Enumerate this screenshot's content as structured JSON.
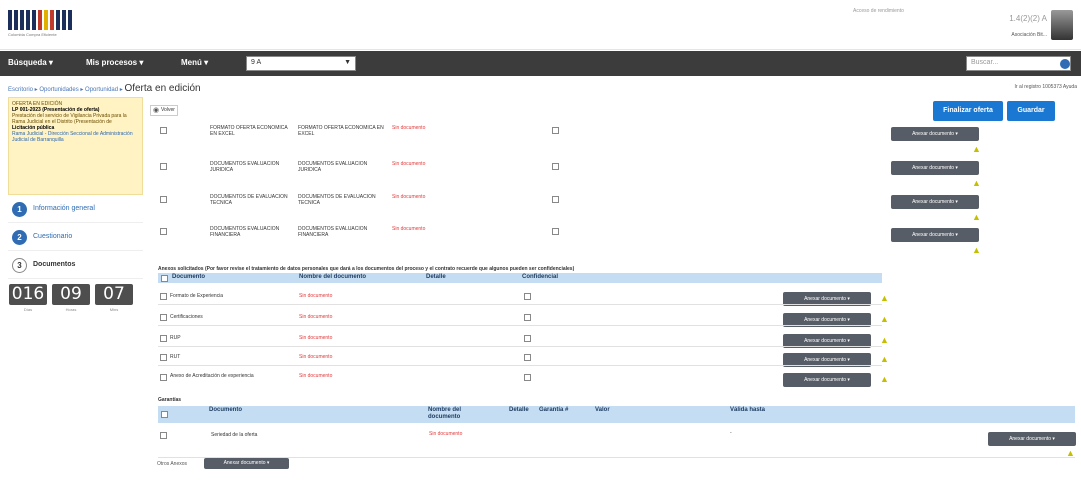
{
  "brand": {
    "logo_caption": "Colombia Compra Eficiente"
  },
  "user": {
    "notice": "Acceso de rendimiento",
    "code": "1.4(2)(2) A",
    "name": "Asociación Bit..."
  },
  "nav": {
    "items": [
      {
        "label": "Búsqueda ▾"
      },
      {
        "label": "Mis procesos ▾"
      },
      {
        "label": "Menú ▾"
      }
    ],
    "select_value": "9 A",
    "search_placeholder": "Buscar..."
  },
  "breadcrumb": {
    "path": "Escritorio ▸ Oportunidades ▸ Oportunidad ▸",
    "current": "Oferta en edición",
    "right": "Ir al registro 1005373 Ayuda"
  },
  "sidebar": {
    "notice_lines": [
      "OFERTA EN EDICIÓN",
      "LP 001-2023 (Presentación de oferta)",
      "Prestación del servicio de Vigilancia Privada para la Rama Judicial en el Distrito (Presentación de",
      "Licitación pública",
      "Rama Judicial - Dirección Seccional de Administración Judicial de Barranquilla"
    ],
    "steps": [
      {
        "num": "1",
        "label": "Información general"
      },
      {
        "num": "2",
        "label": "Cuestionario"
      },
      {
        "num": "3",
        "label": "Documentos"
      }
    ],
    "timer": [
      {
        "value": "016",
        "label": "Días"
      },
      {
        "value": "09",
        "label": "Horas"
      },
      {
        "value": "07",
        "label": "Mins"
      }
    ]
  },
  "main": {
    "back_label": "Volver",
    "finalize_button": "Finalizar oferta",
    "save_button": "Guardar",
    "attach_button": "Anexar documento ▾",
    "missing_doc": "Sin documento",
    "economic_docs": [
      {
        "doc": "FORMATO OFERTA ECONOMICA EN EXCEL",
        "name": "FORMATO OFERTA ECONOMICA EN EXCEL"
      },
      {
        "doc": "DOCUMENTOS EVALUACION JURIDICA",
        "name": "DOCUMENTOS EVALUACION JURIDICA"
      },
      {
        "doc": "DOCUMENTOS DE EVALUACION TECNICA",
        "name": "DOCUMENTOS DE EVALUACION TECNICA"
      },
      {
        "doc": "DOCUMENTOS EVALUACION FINANCIERA",
        "name": "DOCUMENTOS EVALUACION FINANCIERA"
      }
    ],
    "requested_title": "Anexos solicitados (Por favor revise el tratamiento de datos personales que dará a los documentos del proceso y el contrato recuerde que algunos pueden ser confidenciales)",
    "requested_headers": [
      "Documento",
      "Nombre del documento",
      "Detalle",
      "Confidencial"
    ],
    "requested_rows": [
      {
        "doc": "Formato de Experiencia"
      },
      {
        "doc": "Certificaciones"
      },
      {
        "doc": "RUP"
      },
      {
        "doc": "RUT"
      },
      {
        "doc": "Anexo de Acreditación de experiencia"
      }
    ],
    "guarantees_title": "Garantías",
    "guarantee_headers": [
      "Documento",
      "Nombre del documento",
      "Detalle",
      "Garantía #",
      "Valor",
      "Válida hasta"
    ],
    "guarantee_rows": [
      {
        "doc": "Seriedad de la oferta",
        "valid": "-"
      }
    ],
    "other_annex_label": "Otros Anexos"
  }
}
